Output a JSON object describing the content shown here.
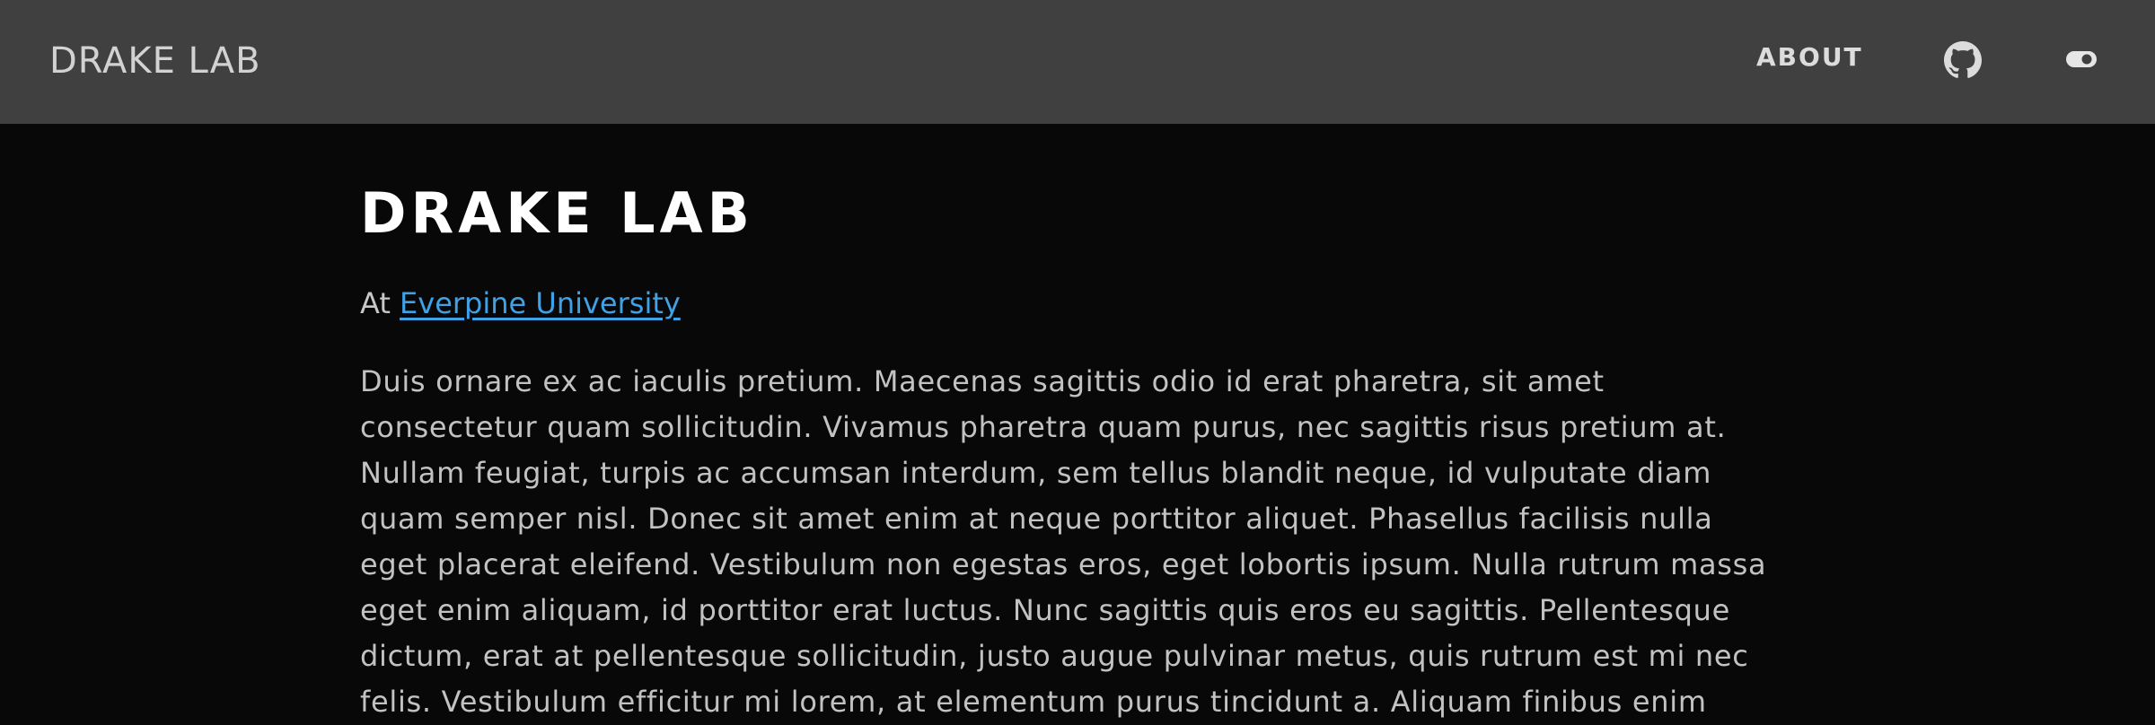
{
  "navbar": {
    "brand": "DRAKE LAB",
    "about_label": "ABOUT",
    "github_icon": "github-icon",
    "theme_icon": "theme-toggle-icon",
    "background": "#404040"
  },
  "main": {
    "title": "DRAKE LAB",
    "subtitle_prefix": "At ",
    "university_link": "Everpine University",
    "link_color": "#3fa2e6",
    "body_lines": [
      "Duis ornare ex ac iaculis pretium. Maecenas sagittis odio id erat pharetra, sit amet",
      "consectetur quam sollicitudin. Vivamus pharetra quam purus, nec sagittis risus pretium at.",
      "Nullam feugiat, turpis ac accumsan interdum, sem tellus blandit neque, id vulputate diam",
      "quam semper nisl. Donec sit amet enim at neque porttitor aliquet. Phasellus facilisis nulla",
      "eget placerat eleifend. Vestibulum non egestas eros, eget lobortis ipsum. Nulla rutrum massa",
      "eget enim aliquam, id porttitor erat luctus. Nunc sagittis quis eros eu sagittis. Pellentesque",
      "dictum, erat at pellentesque sollicitudin, justo augue pulvinar metus, quis rutrum est mi nec",
      "felis. Vestibulum efficitur mi lorem, at elementum purus tincidunt a. Aliquam finibus enim"
    ],
    "page_background": "#080808"
  }
}
